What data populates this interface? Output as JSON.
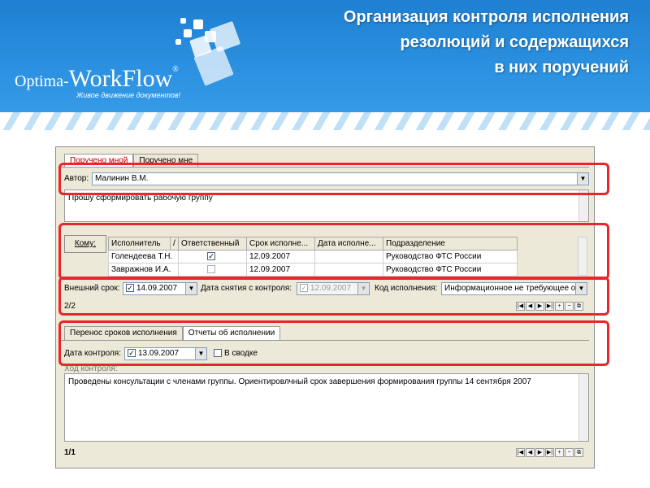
{
  "header": {
    "title_lines": [
      "Организация контроля исполнения",
      "резолюций и содержащихся",
      "в них поручений"
    ],
    "logo_prefix": "Optima-",
    "logo_name": "WorkFlow",
    "logo_reg": "®",
    "logo_tagline": "Живое движение документов!"
  },
  "tabs_top": [
    {
      "label": "Поручено мной",
      "active": true
    },
    {
      "label": "Поручено мне",
      "active": false
    }
  ],
  "author": {
    "label": "Автор:",
    "value": "Малинин В.М."
  },
  "instruction_text": "Прошу сформировать рабочую группу",
  "recipients": {
    "button_label": "Кому:",
    "columns": [
      "Исполнитель",
      "/",
      "Ответственный",
      "Срок исполне...",
      "Дата исполне...",
      "Подразделение"
    ],
    "rows": [
      {
        "executor": "Голендеева Т.Н.",
        "responsible": true,
        "due": "12.09.2007",
        "done": "",
        "dept": "Руководство ФТС России"
      },
      {
        "executor": "Завражнов И.А.",
        "responsible": false,
        "due": "12.09.2007",
        "done": "",
        "dept": "Руководство ФТС России"
      }
    ]
  },
  "control": {
    "external_due_label": "Внешний срок:",
    "external_due_value": "14.09.2007",
    "removal_date_label": "Дата снятия с контроля:",
    "removal_date_value": "12.09.2007",
    "exec_code_label": "Код исполнения:",
    "exec_code_value": "Информационное не требующее о",
    "pager": "2/2"
  },
  "tabs_mid": [
    {
      "label": "Перенос сроков исполнения",
      "active": true
    },
    {
      "label": "Отчеты об исполнении",
      "active": false
    }
  ],
  "report": {
    "control_date_label": "Дата контроля:",
    "control_date_value": "13.09.2007",
    "summary_label": "В сводке",
    "course_label": "Ход контроля:",
    "course_text": "Проведены консультации с членами группы. Ориентировлчный срок завершения формирования группы 14 сентября 2007",
    "pager": "1/1"
  },
  "colors": {
    "highlight": "#e8262b",
    "banner": "#2d93e2"
  }
}
